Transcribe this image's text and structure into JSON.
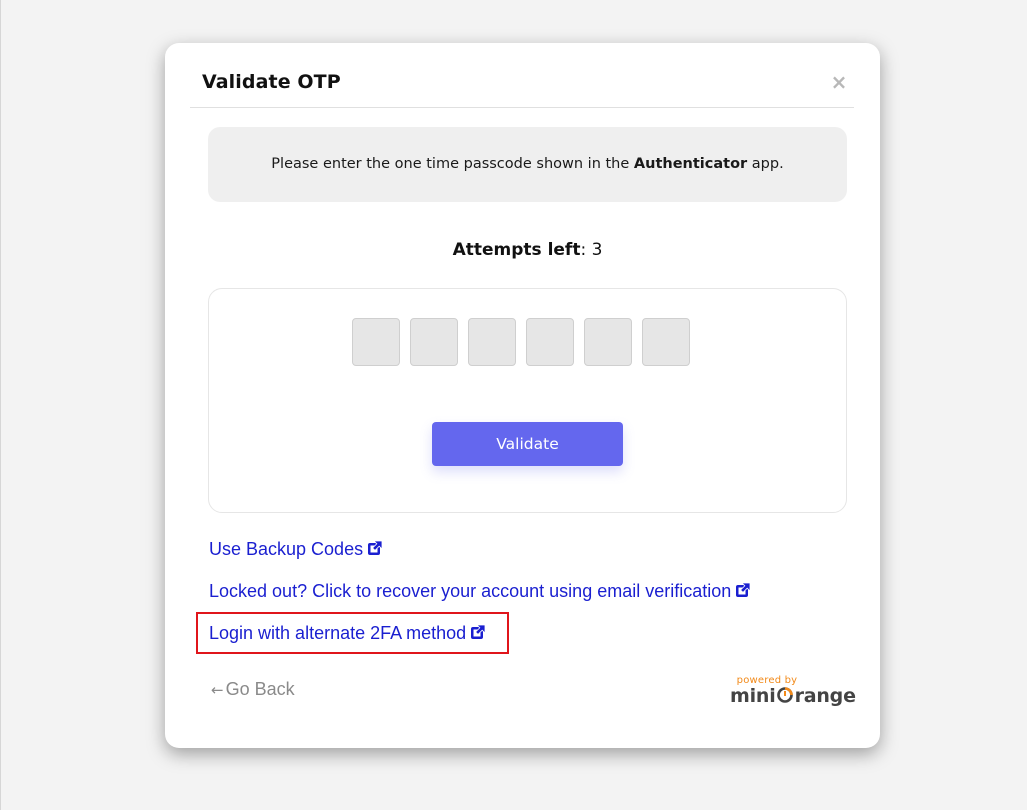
{
  "modal": {
    "title": "Validate OTP",
    "close_icon": "close-icon"
  },
  "info": {
    "text_before": "Please enter the one time passcode shown in the ",
    "app_name": "Authenticator",
    "text_after": " app."
  },
  "attempts": {
    "label": "Attempts left",
    "separator": ": ",
    "count": "3"
  },
  "otp": {
    "digits": [
      "",
      "",
      "",
      "",
      "",
      ""
    ]
  },
  "validate_button": {
    "label": "Validate",
    "color": "#6467ee"
  },
  "links": {
    "backup_codes": "Use Backup Codes",
    "recover_account": "Locked out? Click to recover your account using email verification",
    "alternate_2fa": "Login with alternate 2FA method",
    "link_color": "#1a1fd0",
    "external_icon": "external-link-icon"
  },
  "highlight": {
    "color": "#e0151b"
  },
  "footer": {
    "go_back_arrow": "←",
    "go_back_label": "Go Back",
    "powered_by": "powered by",
    "brand_name_part1": "mini",
    "brand_name_part2": "range",
    "brand_icon": "miniorange-logo-icon",
    "brand_accent": "#f28a1a"
  }
}
